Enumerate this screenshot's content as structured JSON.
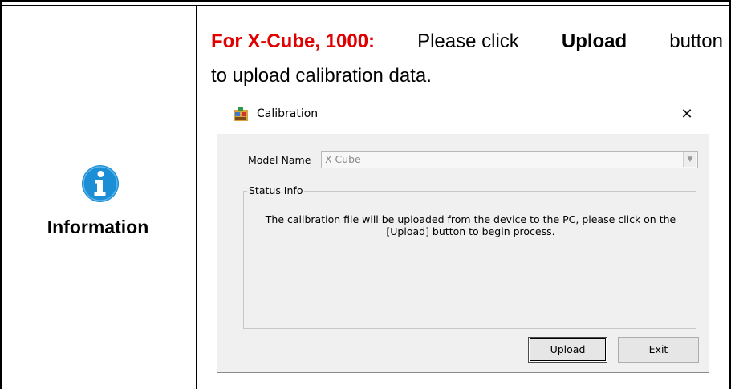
{
  "sidebar": {
    "icon": "info-circle-icon",
    "label": "Information",
    "icon_color": "#1b8ed6"
  },
  "instruction": {
    "highlight": "For X-Cube, 1000:",
    "text_before_button": "Please click",
    "button_word": "Upload",
    "text_after_button": "button",
    "line2": "to upload calibration data.",
    "highlight_color": "#e00000"
  },
  "dialog": {
    "title": "Calibration",
    "app_icon": "calibration-app-icon",
    "close_glyph": "✕",
    "model_label": "Model Name",
    "model_value": "X-Cube",
    "status_legend": "Status Info",
    "status_line1": "The calibration file will be uploaded from the device to the PC, please click on the",
    "status_line2": "[Upload] button to begin process.",
    "upload_label": "Upload",
    "exit_label": "Exit"
  }
}
